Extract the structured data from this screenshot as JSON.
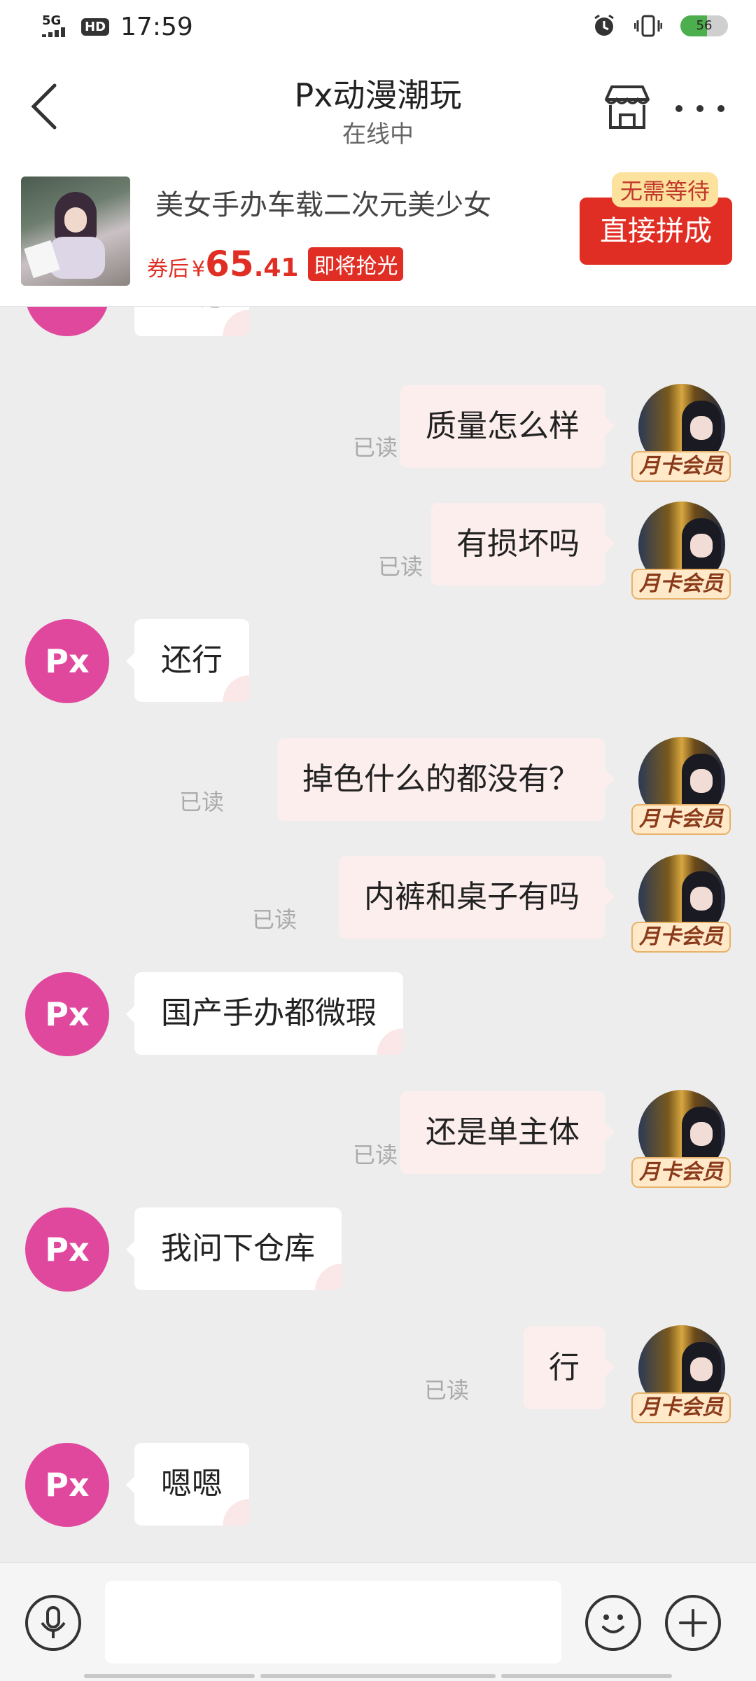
{
  "status_bar": {
    "network": "5G",
    "hd": "HD",
    "time": "17:59",
    "battery": "56",
    "battery_level": 0.56,
    "icons": [
      "signal-icon",
      "alarm-icon",
      "vibrate-icon",
      "battery-icon"
    ]
  },
  "header": {
    "title": "Px动漫潮玩",
    "status": "在线中",
    "icons": [
      "back-arrow-icon",
      "shop-icon",
      "more-icon"
    ]
  },
  "product": {
    "title": "美女手办车载二次元美少女",
    "coupon_label": "券后",
    "currency": "¥",
    "price_int": "65",
    "price_dec": ".41",
    "hot_tag": "即将抢光",
    "no_wait": "无需等待",
    "buy_label": "直接拼成"
  },
  "chat": {
    "peer_avatar": "Px",
    "vip_badge": "月卡会员",
    "read_label": "已读",
    "messages": [
      {
        "side": "in",
        "text": "嗯呢"
      },
      {
        "side": "out",
        "text": "质量怎么样",
        "read": "已读"
      },
      {
        "side": "out",
        "text": "有损坏吗",
        "read": "已读"
      },
      {
        "side": "in",
        "text": "还行"
      },
      {
        "side": "out",
        "text": "掉色什么的都没有？",
        "read": "已读"
      },
      {
        "side": "out",
        "text": "内裤和桌子有吗",
        "read": "已读"
      },
      {
        "side": "in",
        "text": "国产手办都微瑕"
      },
      {
        "side": "out",
        "text": "还是单主体",
        "read": "已读"
      },
      {
        "side": "in",
        "text": "我问下仓库"
      },
      {
        "side": "out",
        "text": "行",
        "read": "已读"
      },
      {
        "side": "in",
        "text": "嗯嗯"
      }
    ]
  },
  "input_bar": {
    "placeholder": "",
    "icons": [
      "microphone-icon",
      "emoji-icon",
      "plus-icon"
    ]
  }
}
